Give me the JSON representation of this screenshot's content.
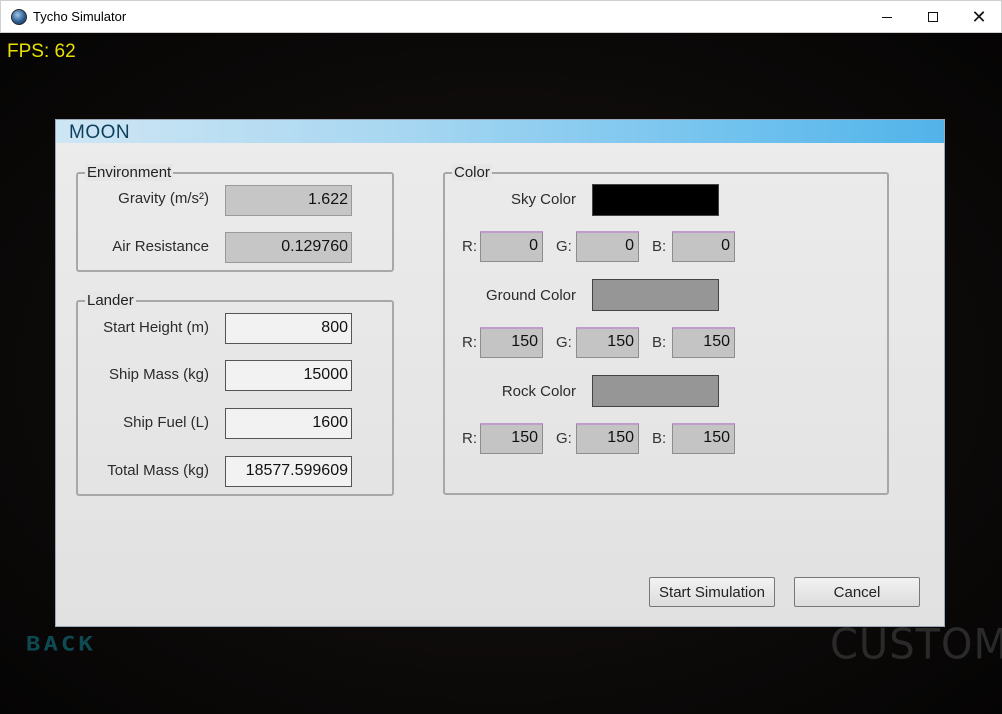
{
  "window": {
    "title": "Tycho Simulator",
    "icon": "globe-icon"
  },
  "hud": {
    "fps": "FPS: 62"
  },
  "background": {
    "back_label": "BACK",
    "custom_label": "CUSTOM"
  },
  "dialog": {
    "title": "MOON",
    "environment": {
      "legend": "Environment",
      "gravity_label": "Gravity (m/s²)",
      "gravity_value": "1.622",
      "air_label": "Air Resistance",
      "air_value": "0.129760"
    },
    "lander": {
      "legend": "Lander",
      "height_label": "Start Height (m)",
      "height_value": "800",
      "mass_label": "Ship Mass (kg)",
      "mass_value": "15000",
      "fuel_label": "Ship Fuel (L)",
      "fuel_value": "1600",
      "total_label": "Total Mass (kg)",
      "total_value": "18577.599609"
    },
    "color": {
      "legend": "Color",
      "sky": {
        "label": "Sky Color",
        "r": "0",
        "g": "0",
        "b": "0",
        "hex": "#000000"
      },
      "ground": {
        "label": "Ground Color",
        "r": "150",
        "g": "150",
        "b": "150",
        "hex": "#969696"
      },
      "rock": {
        "label": "Rock Color",
        "r": "150",
        "g": "150",
        "b": "150",
        "hex": "#969696"
      },
      "r_label": "R:",
      "g_label": "G:",
      "b_label": "B:"
    },
    "buttons": {
      "start": "Start Simulation",
      "cancel": "Cancel"
    }
  }
}
